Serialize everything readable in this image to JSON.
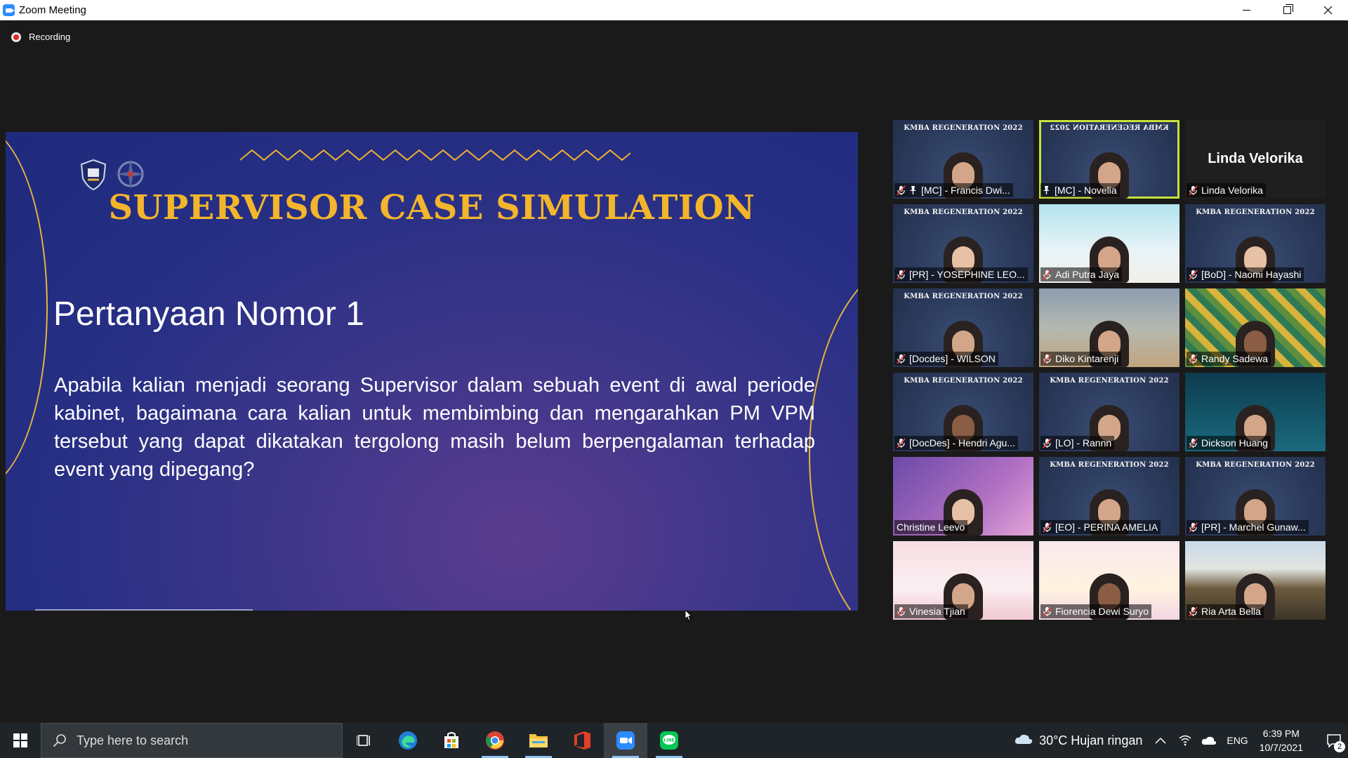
{
  "window": {
    "title": "Zoom Meeting"
  },
  "meeting": {
    "recording_label": "Recording"
  },
  "slide": {
    "title": "SUPERVISOR CASE SIMULATION",
    "subtitle": "Pertanyaan Nomor 1",
    "body": "Apabila kalian menjadi seorang Supervisor dalam sebuah event di awal periode kabinet, bagaimana  cara kalian untuk membimbing dan mengarahkan PM VPM tersebut yang  dapat dikatakan tergolong masih belum berpengalaman terhadap event yang dipegang?",
    "accent_color": "#f3b52c"
  },
  "gallery": {
    "banner_text": "KMBA REGENERATION 2022",
    "active_border_color": "#c6e23a",
    "tiles": [
      {
        "name": "[MC] - Francis Dwi...",
        "muted": true,
        "pinned": true,
        "video": "kmba"
      },
      {
        "name": "[MC] - Novelia",
        "muted": false,
        "pinned": true,
        "video": "kmba-mirrored",
        "active_speaker": true
      },
      {
        "name": "Linda Velorika",
        "muted": true,
        "pinned": false,
        "video": "off",
        "display_name": "Linda Velorika"
      },
      {
        "name": "[PR] - YOSEPHINE LEO...",
        "muted": true,
        "pinned": false,
        "video": "kmba"
      },
      {
        "name": "Adi Putra Jaya",
        "muted": true,
        "pinned": false,
        "video": "custom-sky"
      },
      {
        "name": "[BoD] - Naomi Hayashi",
        "muted": true,
        "pinned": false,
        "video": "kmba"
      },
      {
        "name": "[Docdes] - WILSON",
        "muted": true,
        "pinned": false,
        "video": "kmba"
      },
      {
        "name": "Diko Kintarenji",
        "muted": true,
        "pinned": false,
        "video": "custom-tree"
      },
      {
        "name": "Randy Sadewa",
        "muted": true,
        "pinned": false,
        "video": "custom-pattern"
      },
      {
        "name": "[DocDes] - Hendri Agu...",
        "muted": true,
        "pinned": false,
        "video": "kmba"
      },
      {
        "name": "[LO] - Rannn",
        "muted": true,
        "pinned": false,
        "video": "kmba"
      },
      {
        "name": "Dickson Huang",
        "muted": true,
        "pinned": false,
        "video": "custom-tech"
      },
      {
        "name": "Christine Leevo",
        "muted": false,
        "pinned": false,
        "video": "custom-purple"
      },
      {
        "name": "[EO] - PERINA AMELIA",
        "muted": true,
        "pinned": false,
        "video": "kmba"
      },
      {
        "name": "[PR] - Marchel Gunaw...",
        "muted": true,
        "pinned": false,
        "video": "kmba"
      },
      {
        "name": "Vinesia Tjian",
        "muted": true,
        "pinned": false,
        "video": "custom-pink"
      },
      {
        "name": "Fiorencia Dewi Suryo",
        "muted": true,
        "pinned": false,
        "video": "custom-rainbow"
      },
      {
        "name": "Ria Arta Bella",
        "muted": true,
        "pinned": false,
        "video": "custom-road"
      }
    ]
  },
  "taskbar": {
    "search_placeholder": "Type here to search",
    "apps": [
      "task-view-icon",
      "edge-icon",
      "store-icon",
      "chrome-icon",
      "file-explorer-icon",
      "office-icon",
      "zoom-icon",
      "line-icon"
    ],
    "weather": "30°C  Hujan ringan",
    "language": "ENG",
    "time": "6:39 PM",
    "date": "10/7/2021",
    "notification_count": "2"
  }
}
